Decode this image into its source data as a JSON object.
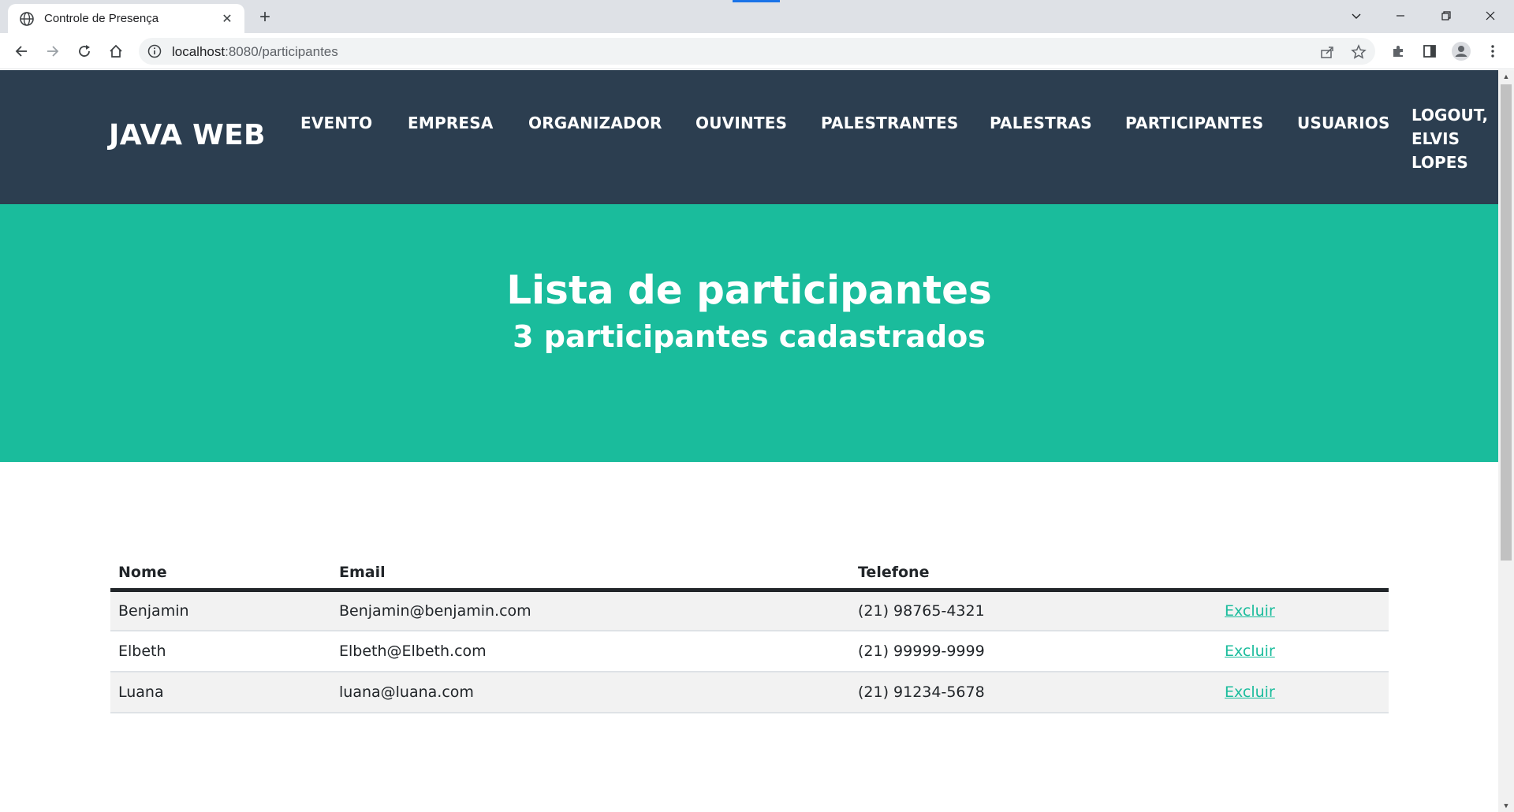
{
  "browser": {
    "tab_title": "Controle de Presença",
    "url_host": "localhost",
    "url_path": ":8080/participantes"
  },
  "navbar": {
    "brand": "JAVA WEB",
    "links": [
      "EVENTO",
      "EMPRESA",
      "ORGANIZADOR",
      "OUVINTES",
      "PALESTRANTES",
      "PALESTRAS",
      "PARTICIPANTES",
      "USUARIOS"
    ],
    "logout_lines": [
      "LOGOUT,",
      "ELVIS",
      "LOPES"
    ]
  },
  "masthead": {
    "title": "Lista de participantes",
    "subtitle": "3 participantes cadastrados"
  },
  "table": {
    "headers": [
      "Nome",
      "Email",
      "Telefone",
      ""
    ],
    "rows": [
      {
        "nome": "Benjamin",
        "email": "Benjamin@benjamin.com",
        "telefone": "(21) 98765-4321",
        "action": "Excluir"
      },
      {
        "nome": "Elbeth",
        "email": "Elbeth@Elbeth.com",
        "telefone": "(21) 99999-9999",
        "action": "Excluir"
      },
      {
        "nome": "Luana",
        "email": "luana@luana.com",
        "telefone": "(21) 91234-5678",
        "action": "Excluir"
      }
    ]
  },
  "colors": {
    "navbar_bg": "#2c3e50",
    "masthead_bg": "#1abc9c",
    "link_color": "#1abc9c",
    "row_stripe": "#f2f2f2"
  },
  "icons": [
    "globe-icon",
    "close-icon",
    "plus-icon",
    "back-arrow-icon",
    "forward-arrow-icon",
    "reload-icon",
    "home-icon",
    "info-icon",
    "share-icon",
    "star-icon",
    "puzzle-icon",
    "side-panel-icon",
    "profile-icon",
    "kebab-menu-icon",
    "chevron-down-icon",
    "minimize-icon",
    "restore-icon"
  ]
}
